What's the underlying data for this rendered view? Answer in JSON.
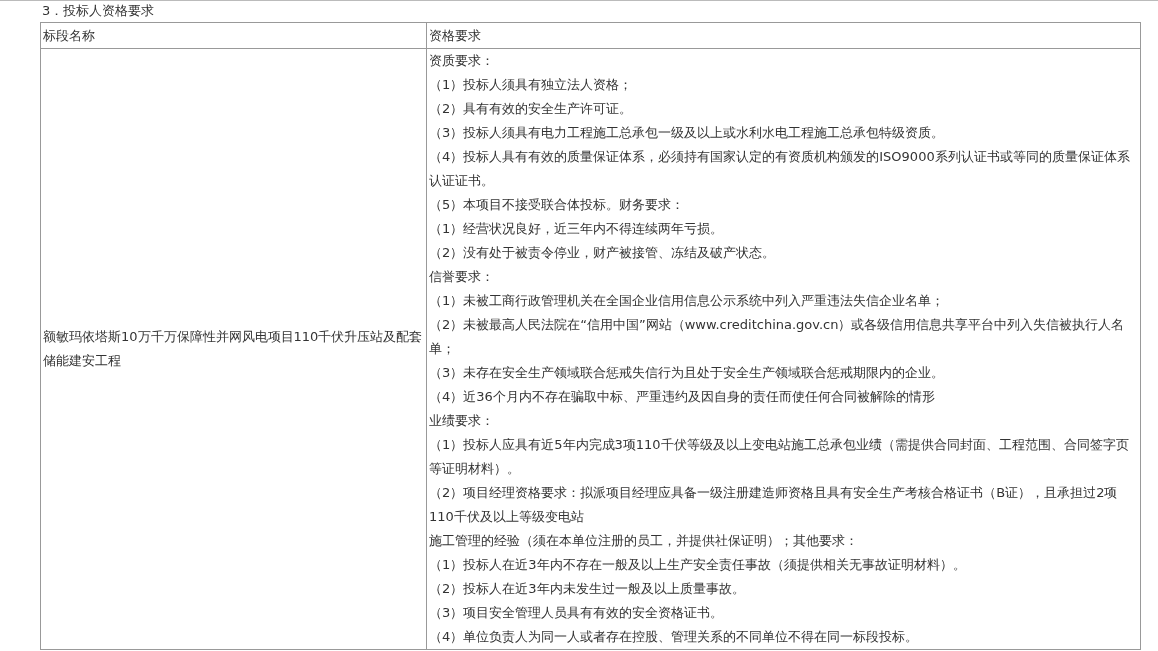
{
  "section_title": "3．投标人资格要求",
  "table": {
    "columns": [
      "标段名称",
      "资格要求"
    ],
    "rows": [
      {
        "segment_name": "额敏玛依塔斯10万千万保障性并网风电项目110千伏升压站及配套储能建安工程",
        "requirements": [
          "资质要求：",
          "（1）投标人须具有独立法人资格；",
          "（2）具有有效的安全生产许可证。",
          "（3）投标人须具有电力工程施工总承包一级及以上或水利水电工程施工总承包特级资质。",
          "（4）投标人具有有效的质量保证体系，必须持有国家认定的有资质机构颁发的ISO9000系列认证书或等同的质量保证体系认证证书。",
          "（5）本项目不接受联合体投标。财务要求：",
          "（1）经营状况良好，近三年内不得连续两年亏损。",
          "（2）没有处于被责令停业，财产被接管、冻结及破产状态。",
          "信誉要求：",
          "（1）未被工商行政管理机关在全国企业信用信息公示系统中列入严重违法失信企业名单；",
          "（2）未被最高人民法院在“信用中国”网站（www.creditchina.gov.cn）或各级信用信息共享平台中列入失信被执行人名单；",
          "（3）未存在安全生产领域联合惩戒失信行为且处于安全生产领域联合惩戒期限内的企业。",
          "（4）近36个月内不存在骗取中标、严重违约及因自身的责任而使任何合同被解除的情形",
          "业绩要求：",
          "（1）投标人应具有近5年内完成3项110千伏等级及以上变电站施工总承包业绩（需提供合同封面、工程范围、合同签字页等证明材料）。",
          "（2）项目经理资格要求：拟派项目经理应具备一级注册建造师资格且具有安全生产考核合格证书（B证），且承担过2项110千伏及以上等级变电站",
          "施工管理的经验（须在本单位注册的员工，并提供社保证明）；其他要求：",
          "（1）投标人在近3年内不存在一般及以上生产安全责任事故（须提供相关无事故证明材料）。",
          "（2）投标人在近3年内未发生过一般及以上质量事故。",
          "（3）项目安全管理人员具有有效的安全资格证书。",
          "（4）单位负责人为同一人或者存在控股、管理关系的不同单位不得在同一标段投标。"
        ]
      }
    ]
  }
}
